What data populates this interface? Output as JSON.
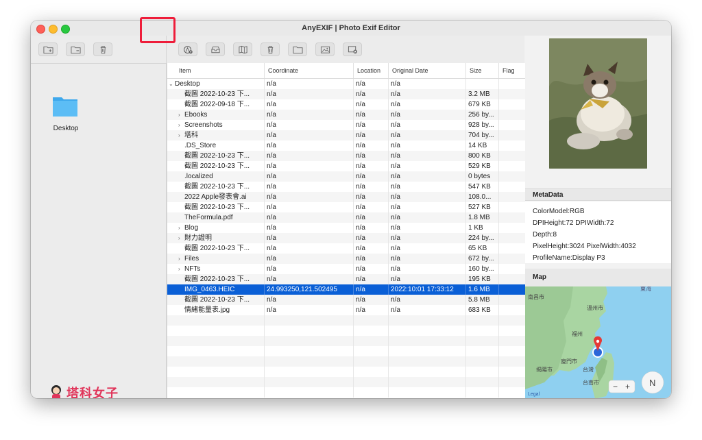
{
  "window": {
    "title": "AnyEXIF | Photo Exif Editor"
  },
  "sidebar": {
    "toolbar": [
      {
        "name": "add-folder-icon"
      },
      {
        "name": "remove-folder-icon"
      },
      {
        "name": "trash-icon"
      }
    ],
    "folder": {
      "label": "Desktop"
    },
    "logo": {
      "text": "塔科女子"
    }
  },
  "main_toolbar": [
    {
      "name": "add-location-icon"
    },
    {
      "name": "inbox-icon"
    },
    {
      "name": "map-icon"
    },
    {
      "name": "trash-icon"
    },
    {
      "name": "folder-icon"
    },
    {
      "name": "photo-icon"
    },
    {
      "name": "remove-photo-icon"
    }
  ],
  "table": {
    "columns": [
      "Item",
      "Coordinate",
      "Location",
      "Original Date",
      "Size",
      "Flag"
    ],
    "rows": [
      {
        "item": "Desktop",
        "coord": "n/a",
        "loc": "n/a",
        "date": "n/a",
        "size": "",
        "flag": "",
        "chev": "v",
        "indent": 0
      },
      {
        "item": "截圖 2022-10-23 下...",
        "coord": "n/a",
        "loc": "n/a",
        "date": "n/a",
        "size": "3.2 MB",
        "flag": "",
        "chev": "",
        "indent": 1
      },
      {
        "item": "截圖 2022-09-18 下...",
        "coord": "n/a",
        "loc": "n/a",
        "date": "n/a",
        "size": "679 KB",
        "flag": "",
        "chev": "",
        "indent": 1
      },
      {
        "item": "Ebooks",
        "coord": "n/a",
        "loc": "n/a",
        "date": "n/a",
        "size": "256 by...",
        "flag": "",
        "chev": ">",
        "indent": 1
      },
      {
        "item": "Screenshots",
        "coord": "n/a",
        "loc": "n/a",
        "date": "n/a",
        "size": "928 by...",
        "flag": "",
        "chev": ">",
        "indent": 1
      },
      {
        "item": "塔科",
        "coord": "n/a",
        "loc": "n/a",
        "date": "n/a",
        "size": "704 by...",
        "flag": "",
        "chev": ">",
        "indent": 1
      },
      {
        "item": ".DS_Store",
        "coord": "n/a",
        "loc": "n/a",
        "date": "n/a",
        "size": "14 KB",
        "flag": "",
        "chev": "",
        "indent": 1
      },
      {
        "item": "截圖 2022-10-23 下...",
        "coord": "n/a",
        "loc": "n/a",
        "date": "n/a",
        "size": "800 KB",
        "flag": "",
        "chev": "",
        "indent": 1
      },
      {
        "item": "截圖 2022-10-23 下...",
        "coord": "n/a",
        "loc": "n/a",
        "date": "n/a",
        "size": "529 KB",
        "flag": "",
        "chev": "",
        "indent": 1
      },
      {
        "item": ".localized",
        "coord": "n/a",
        "loc": "n/a",
        "date": "n/a",
        "size": "0 bytes",
        "flag": "",
        "chev": "",
        "indent": 1
      },
      {
        "item": "截圖 2022-10-23 下...",
        "coord": "n/a",
        "loc": "n/a",
        "date": "n/a",
        "size": "547 KB",
        "flag": "",
        "chev": "",
        "indent": 1
      },
      {
        "item": "2022 Apple發表會.ai",
        "coord": "n/a",
        "loc": "n/a",
        "date": "n/a",
        "size": "108.0...",
        "flag": "",
        "chev": "",
        "indent": 1
      },
      {
        "item": "截圖 2022-10-23 下...",
        "coord": "n/a",
        "loc": "n/a",
        "date": "n/a",
        "size": "527 KB",
        "flag": "",
        "chev": "",
        "indent": 1
      },
      {
        "item": "TheFormula.pdf",
        "coord": "n/a",
        "loc": "n/a",
        "date": "n/a",
        "size": "1.8 MB",
        "flag": "",
        "chev": "",
        "indent": 1
      },
      {
        "item": "Blog",
        "coord": "n/a",
        "loc": "n/a",
        "date": "n/a",
        "size": "1 KB",
        "flag": "",
        "chev": ">",
        "indent": 1
      },
      {
        "item": "財力證明",
        "coord": "n/a",
        "loc": "n/a",
        "date": "n/a",
        "size": "224 by...",
        "flag": "",
        "chev": ">",
        "indent": 1
      },
      {
        "item": "截圖 2022-10-23 下...",
        "coord": "n/a",
        "loc": "n/a",
        "date": "n/a",
        "size": "65 KB",
        "flag": "",
        "chev": "",
        "indent": 1
      },
      {
        "item": "Files",
        "coord": "n/a",
        "loc": "n/a",
        "date": "n/a",
        "size": "672 by...",
        "flag": "",
        "chev": ">",
        "indent": 1
      },
      {
        "item": "NFTs",
        "coord": "n/a",
        "loc": "n/a",
        "date": "n/a",
        "size": "160 by...",
        "flag": "",
        "chev": ">",
        "indent": 1
      },
      {
        "item": "截圖 2022-10-23 下...",
        "coord": "n/a",
        "loc": "n/a",
        "date": "n/a",
        "size": "195 KB",
        "flag": "",
        "chev": "",
        "indent": 1
      },
      {
        "item": "IMG_0463.HEIC",
        "coord": "24.993250,121.502495",
        "loc": "n/a",
        "date": "2022:10:01 17:33:12",
        "size": "1.6 MB",
        "flag": "",
        "chev": "",
        "indent": 1,
        "selected": true
      },
      {
        "item": "截圖 2022-10-23 下...",
        "coord": "n/a",
        "loc": "n/a",
        "date": "n/a",
        "size": "5.8 MB",
        "flag": "",
        "chev": "",
        "indent": 1
      },
      {
        "item": "情緒能量表.jpg",
        "coord": "n/a",
        "loc": "n/a",
        "date": "n/a",
        "size": "683 KB",
        "flag": "",
        "chev": "",
        "indent": 1
      }
    ]
  },
  "metadata": {
    "title": "MetaData",
    "lines": [
      "ColorModel:RGB",
      "DPIHeight:72  DPIWidth:72",
      "Depth:8",
      "PixelHeight:3024  PixelWidth:4032",
      "ProfileName:Display P3"
    ]
  },
  "map": {
    "title": "Map",
    "labels": [
      "南昌市",
      "溫州市",
      "東海",
      "福州",
      "廈門市",
      "揭陽市",
      "台灣",
      "台南市"
    ],
    "legal": "Legal",
    "compass": "N",
    "zoom_out": "−",
    "zoom_in": "+"
  }
}
